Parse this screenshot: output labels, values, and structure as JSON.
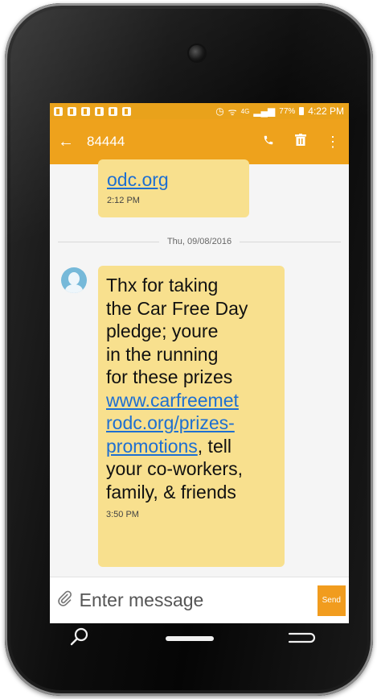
{
  "status_bar": {
    "network": "4G",
    "battery": "77%",
    "time": "4:22 PM"
  },
  "toolbar": {
    "title": "84444",
    "icons": [
      "back-arrow-icon",
      "phone-icon",
      "trash-icon",
      "more-vert-icon"
    ]
  },
  "messages": {
    "previous": {
      "link": "odc.org",
      "time": "2:12 PM"
    },
    "date_separator": "Thu, 09/08/2016",
    "latest": {
      "text_lines": [
        "Thx for taking",
        "the Car Free Day",
        "pledge; youre",
        "in the running",
        "for these prizes"
      ],
      "link_lines": [
        "www.carfreemet",
        "rodc.org/prizes-",
        "promotions"
      ],
      "after_link": ", tell",
      "tail_lines": [
        "your co-workers,",
        "family, & friends"
      ],
      "time": "3:50 PM"
    }
  },
  "composer": {
    "placeholder": "Enter message",
    "send_label": "Send"
  },
  "colors": {
    "accent": "#eea21c",
    "bubble": "#f8e08e",
    "link": "#1e6fd1"
  }
}
